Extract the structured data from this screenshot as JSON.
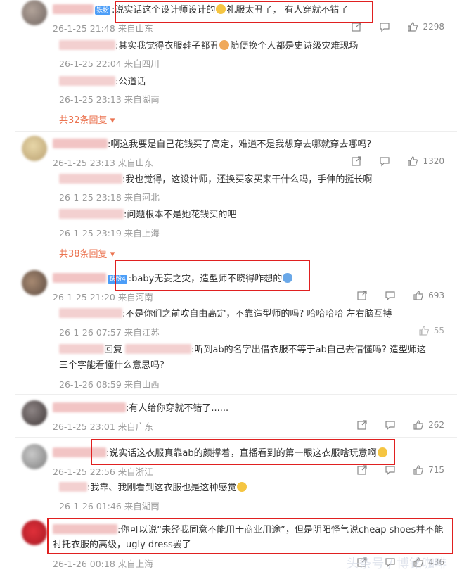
{
  "comments": [
    {
      "text": ":说实话这个设计师设计的",
      "text2": "礼服太丑了，  有人穿就不错了",
      "badge": "铁粉",
      "time": "26-1-25 21:48",
      "loc": "来自山东",
      "likes": "2298",
      "replies": [
        {
          "text": ":其实我觉得衣服鞋子都丑",
          "text2": "随便换个人都是史诗级灾难现场",
          "time": "26-1-25 22:04",
          "loc": "来自四川"
        },
        {
          "text": ":公道话",
          "time": "26-1-25 23:13",
          "loc": "来自湖南"
        }
      ],
      "more": "共32条回复"
    },
    {
      "text": ":啊这我要是自己花钱买了高定，难道不是我想穿去哪就穿去哪吗?",
      "time": "26-1-25 23:13",
      "loc": "来自山东",
      "likes": "1320",
      "replies": [
        {
          "text": ":我也觉得，这设计师，还换买家买来干什么吗，手伸的挺长啊",
          "time": "26-1-25 23:18",
          "loc": "来自河北"
        },
        {
          "text": ":问题根本不是她花钱买的吧",
          "time": "26-1-25 23:19",
          "loc": "来自上海"
        }
      ],
      "more": "共38条回复"
    },
    {
      "text": ":baby无妄之灾，造型师不晓得咋想的",
      "badge": "铁粉4",
      "time": "26-1-25 21:20",
      "loc": "来自河南",
      "likes": "693",
      "replies": [
        {
          "text": ":不是你们之前吹自由高定，不靠造型师的吗? 哈哈哈哈 左右脑互搏",
          "time": "26-1-26 07:57",
          "loc": "来自江苏",
          "likes": "55"
        },
        {
          "text": "回复",
          "text2": ":听到ab的名字出借衣服不等于ab自己去借懂吗? 造型师这",
          "text3": "三个字能看懂什么意思吗?",
          "time": "26-1-26 08:59",
          "loc": "来自山西"
        }
      ]
    },
    {
      "text": ":有人给你穿就不错了......",
      "time": "26-1-25 23:01",
      "loc": "来自广东",
      "likes": "262"
    },
    {
      "text": ":说实话这衣服真靠ab的颜撑着，直播看到的第一眼这衣服啥玩意啊",
      "time": "26-1-25 22:56",
      "loc": "来自浙江",
      "likes": "715",
      "replies": [
        {
          "text": ":我靠、我刚看到这衣服也是这种感觉",
          "time": "26-1-26 01:46",
          "loc": "来自湖南"
        }
      ]
    },
    {
      "text": ":你可以说“未经我同意不能用于商业用途”，但是阴阳怪气说cheap shoes并不能",
      "text2": "衬托衣服的高级，ugly dress罢了",
      "time": "26-1-26 00:18",
      "loc": "来自上海",
      "likes": "436"
    }
  ],
  "colors": {
    "highlight": "#e02020",
    "link": "#eb7350",
    "meta": "#999999"
  },
  "icons": [
    "share-icon",
    "comment-icon",
    "like-icon",
    "dropdown-caret-icon"
  ],
  "watermark": "头条号 / 博铭咖啡"
}
